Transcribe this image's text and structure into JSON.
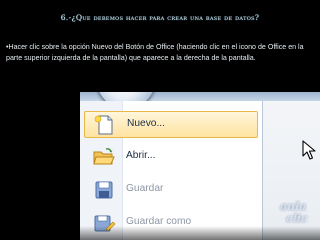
{
  "slide": {
    "title": "6.-¿Que debemos hacer para crear una base de datos?",
    "body": "•Hacer clic sobre la opción Nuevo del Botón de Office (haciendo clic en el icono de Office en la parte superior izquierda de la pantalla) que aparece a la derecha de la pantalla."
  },
  "office_menu": {
    "items": [
      {
        "label": "Nuevo...",
        "icon": "new-document-icon",
        "selected": true
      },
      {
        "label": "Abrir...",
        "icon": "open-folder-icon",
        "selected": false
      },
      {
        "label": "Guardar",
        "icon": "save-icon",
        "selected": false
      },
      {
        "label": "Guardar como",
        "icon": "save-as-icon",
        "selected": false
      }
    ]
  },
  "watermark": {
    "line1": "aula",
    "line2": "clic"
  },
  "colors": {
    "background": "#000000",
    "title": "#cfe6f2",
    "selection_fill": "#ffe3a0",
    "selection_border": "#e8b84a"
  }
}
